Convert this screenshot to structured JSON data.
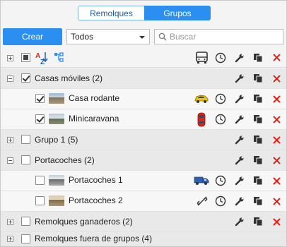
{
  "tabs": {
    "trailers": "Remolques",
    "groups": "Grupos"
  },
  "toolbar": {
    "create": "Crear",
    "filter_value": "Todos",
    "search_placeholder": "Buscar"
  },
  "rows": [
    {
      "name": "Casas móviles (2)"
    },
    {
      "name": "Casa rodante"
    },
    {
      "name": "Minicaravana"
    },
    {
      "name": "Grupo 1 (5)"
    },
    {
      "name": "Portacoches (2)"
    },
    {
      "name": "Portacoches 1"
    },
    {
      "name": "Portacoches 2"
    },
    {
      "name": "Remolques ganaderos (2)"
    },
    {
      "name": "Remolques fuera de grupos (4)"
    }
  ],
  "colors": {
    "accent": "#2a8ff0",
    "delete": "#e2231a",
    "group_row": "#e9e9e9",
    "unit_row": "#f7f7f7"
  },
  "icons": [
    "expand-icon",
    "select-all-icon",
    "sort-az-icon",
    "hierarchy-icon",
    "bus-icon",
    "clock-icon",
    "wrench-icon",
    "copy-icon",
    "delete-icon",
    "yellow-car-icon",
    "red-car-icon",
    "blue-truck-icon",
    "unlink-icon"
  ]
}
